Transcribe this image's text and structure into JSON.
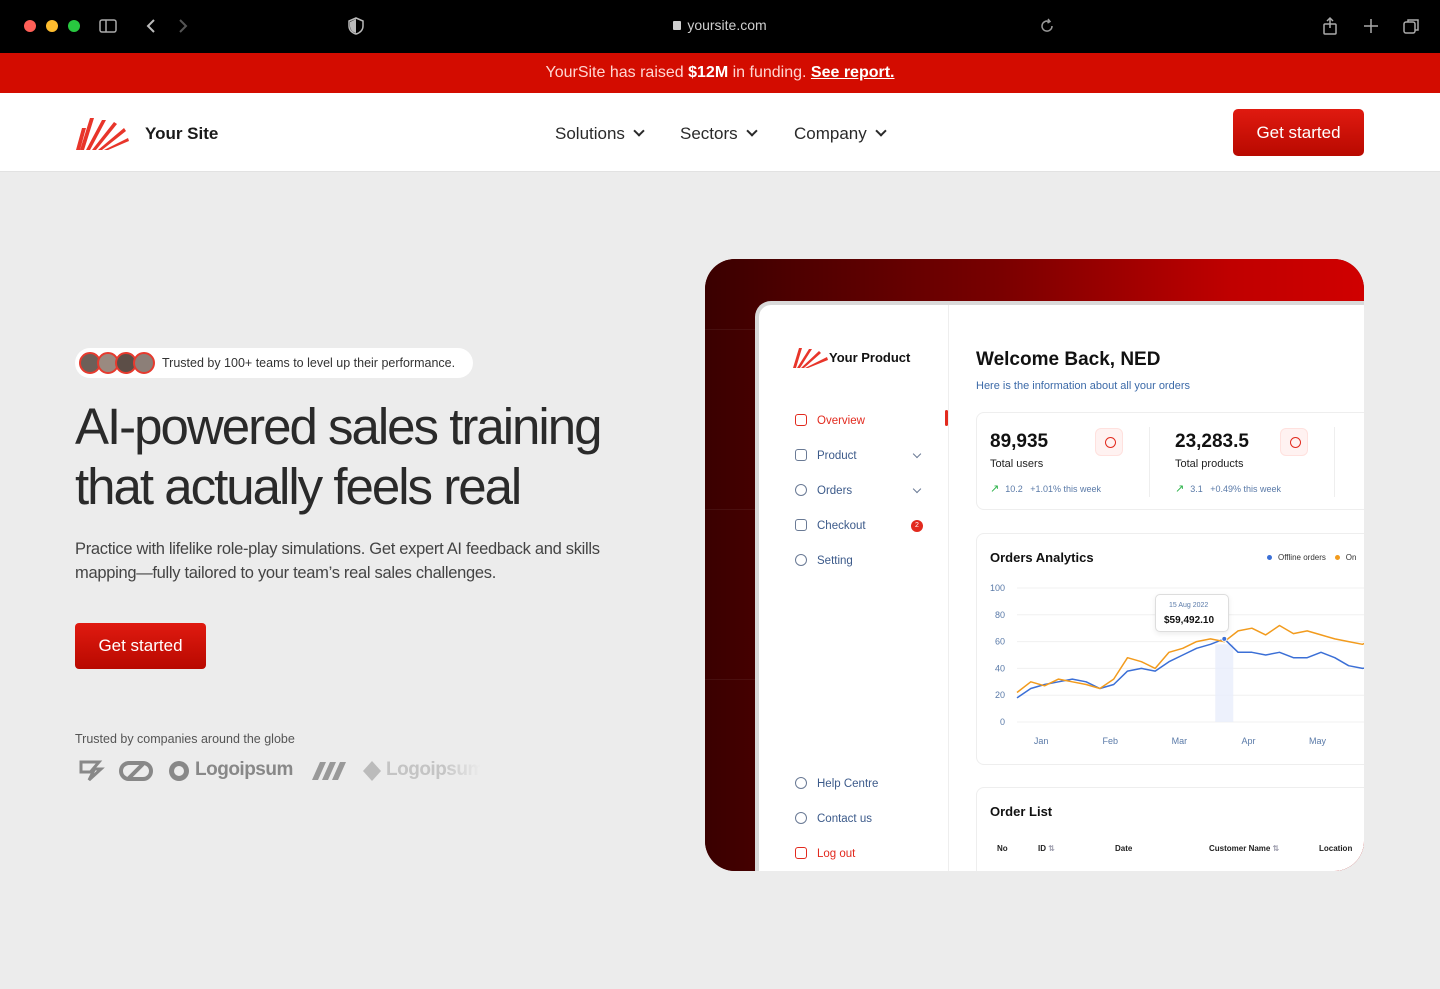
{
  "browser": {
    "url": "yoursite.com",
    "icons": [
      "sidebar-toggle-icon",
      "back-icon",
      "forward-icon",
      "shield-icon",
      "reload-icon",
      "share-icon",
      "new-tab-icon",
      "tabs-icon"
    ]
  },
  "banner": {
    "prefix": "YourSite has raised",
    "amount": "$12M",
    "middle": "in funding.",
    "link": "See report."
  },
  "nav": {
    "brand": "Your Site",
    "menu": [
      "Solutions",
      "Sectors",
      "Company"
    ],
    "cta": "Get started"
  },
  "hero": {
    "trust_badge": "Trusted by 100+ teams to level up their performance.",
    "headline_line1": "AI-powered sales training",
    "headline_line2": "that actually feels real",
    "subtext": "Practice with lifelike role-play simulations. Get expert AI feedback and skills mapping—fully tailored to your team’s real sales challenges.",
    "cta": "Get started",
    "logos_caption": "Trusted by companies around the globe",
    "logo_names": [
      "Logoipsum",
      "Logoipsum"
    ]
  },
  "app": {
    "product_name": "Your Product",
    "sidebar": [
      {
        "label": "Overview",
        "icon": "bar-chart-icon"
      },
      {
        "label": "Product",
        "icon": "box-icon"
      },
      {
        "label": "Orders",
        "icon": "user-icon"
      },
      {
        "label": "Checkout",
        "icon": "receipt-icon",
        "badge": "2"
      },
      {
        "label": "Setting",
        "icon": "gear-icon"
      }
    ],
    "sidebar_bottom": [
      {
        "label": "Help Centre",
        "icon": "info-icon"
      },
      {
        "label": "Contact us",
        "icon": "chat-icon"
      },
      {
        "label": "Log out",
        "icon": "logout-icon"
      }
    ],
    "welcome": "Welcome Back, NED",
    "welcome_sub": "Here is the information about all your orders",
    "stats": [
      {
        "value": "89,935",
        "label": "Total users",
        "trend_value": "10.2",
        "trend_text": "+1.01% this week"
      },
      {
        "value": "23,283.5",
        "label": "Total products",
        "trend_value": "3.1",
        "trend_text": "+0.49% this week"
      }
    ],
    "chart_title": "Orders Analytics",
    "legend": [
      "Offline orders",
      "On"
    ],
    "tooltip_date": "15 Aug 2022",
    "tooltip_value": "$59,492.10",
    "order_list_title": "Order List",
    "order_columns": [
      "No",
      "ID",
      "Date",
      "Customer Name",
      "Location"
    ]
  },
  "colors": {
    "accent": "#d30c00",
    "offline_series": "#3b6fd6",
    "online_series": "#f29b1d"
  },
  "chart_data": {
    "type": "line",
    "title": "Orders Analytics",
    "x_ticks": [
      "Jan",
      "Feb",
      "Mar",
      "Apr",
      "May"
    ],
    "y_ticks": [
      0,
      20,
      40,
      60,
      80,
      100
    ],
    "ylim": [
      0,
      100
    ],
    "xlim": [
      0,
      5.5
    ],
    "legend_position": "top-right",
    "series": [
      {
        "name": "Offline orders",
        "color": "#3b6fd6",
        "points": [
          [
            0,
            18
          ],
          [
            0.2,
            25
          ],
          [
            0.4,
            28
          ],
          [
            0.6,
            30
          ],
          [
            0.8,
            32
          ],
          [
            1.0,
            30
          ],
          [
            1.2,
            25
          ],
          [
            1.4,
            28
          ],
          [
            1.6,
            38
          ],
          [
            1.8,
            40
          ],
          [
            2.0,
            38
          ],
          [
            2.2,
            45
          ],
          [
            2.4,
            50
          ],
          [
            2.6,
            55
          ],
          [
            2.8,
            58
          ],
          [
            3.0,
            62
          ],
          [
            3.2,
            52
          ],
          [
            3.4,
            52
          ],
          [
            3.6,
            50
          ],
          [
            3.8,
            52
          ],
          [
            4.0,
            48
          ],
          [
            4.2,
            48
          ],
          [
            4.4,
            52
          ],
          [
            4.6,
            48
          ],
          [
            4.8,
            42
          ],
          [
            5.0,
            40
          ],
          [
            5.2,
            42
          ],
          [
            5.4,
            45
          ],
          [
            5.5,
            44
          ]
        ]
      },
      {
        "name": "On",
        "color": "#f29b1d",
        "points": [
          [
            0,
            22
          ],
          [
            0.2,
            30
          ],
          [
            0.4,
            27
          ],
          [
            0.6,
            32
          ],
          [
            0.8,
            30
          ],
          [
            1.0,
            28
          ],
          [
            1.2,
            25
          ],
          [
            1.4,
            32
          ],
          [
            1.6,
            48
          ],
          [
            1.8,
            45
          ],
          [
            2.0,
            40
          ],
          [
            2.2,
            52
          ],
          [
            2.4,
            55
          ],
          [
            2.6,
            60
          ],
          [
            2.8,
            62
          ],
          [
            3.0,
            60
          ],
          [
            3.2,
            68
          ],
          [
            3.4,
            70
          ],
          [
            3.6,
            65
          ],
          [
            3.8,
            72
          ],
          [
            4.0,
            66
          ],
          [
            4.2,
            68
          ],
          [
            4.4,
            65
          ],
          [
            4.6,
            62
          ],
          [
            4.8,
            60
          ],
          [
            5.0,
            58
          ],
          [
            5.2,
            63
          ],
          [
            5.4,
            66
          ],
          [
            5.5,
            64
          ]
        ]
      }
    ],
    "highlight": {
      "x": 3.0,
      "label": "15 Aug 2022",
      "value": "$59,492.10"
    }
  }
}
